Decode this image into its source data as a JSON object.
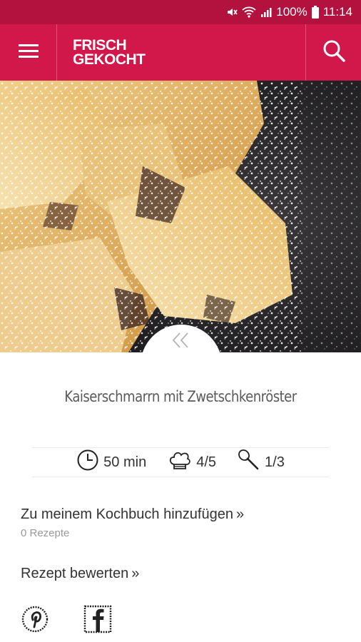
{
  "status_bar": {
    "battery": "100%",
    "time": "11:14"
  },
  "app_bar": {
    "logo_line1": "FRISCH",
    "logo_line2": "GEKOCHT"
  },
  "recipe": {
    "title": "Kaiserschmarrn mit Zwetschkenröster",
    "time": "50 min",
    "difficulty": "4/5",
    "effort": "1/3"
  },
  "cookbook": {
    "label": "Zu meinem Kochbuch hinzufügen",
    "chevron": "»",
    "count": "0 Rezepte"
  },
  "rating": {
    "label": "Rezept bewerten",
    "chevron": "»"
  },
  "colors": {
    "brand": "#d2174b",
    "status": "#b3123e"
  }
}
